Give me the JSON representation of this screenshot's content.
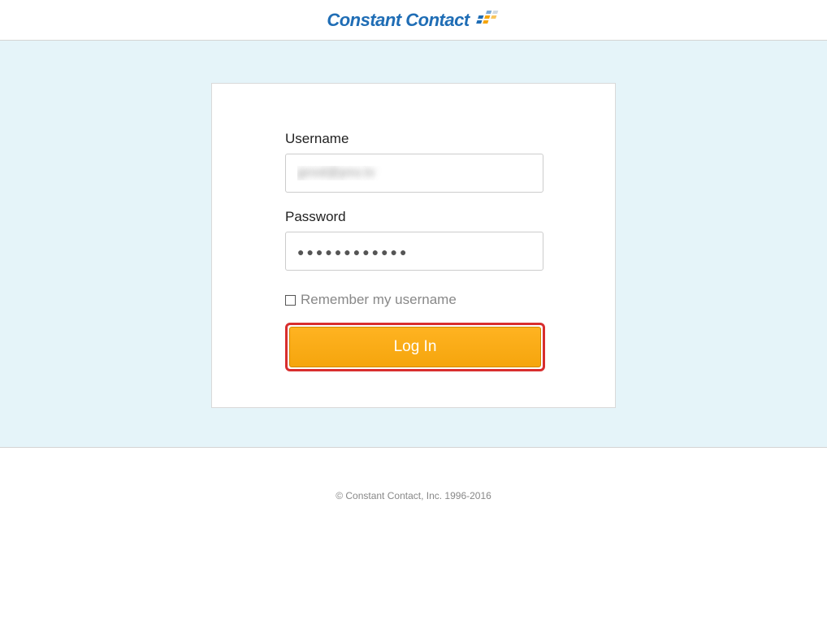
{
  "brand": {
    "name": "Constant Contact"
  },
  "login": {
    "username_label": "Username",
    "username_value": "jprod@pno.tv",
    "password_label": "Password",
    "password_value": "●●●●●●●●●●●●",
    "remember_label": "Remember my username",
    "remember_checked": false,
    "submit_label": "Log In"
  },
  "footer": {
    "copyright": "© Constant Contact, Inc. 1996-2016"
  },
  "colors": {
    "brand_blue": "#1f6db5",
    "brand_orange": "#f5a50d",
    "highlight_red": "#d82e2e",
    "page_bg": "#e5f4f9"
  }
}
